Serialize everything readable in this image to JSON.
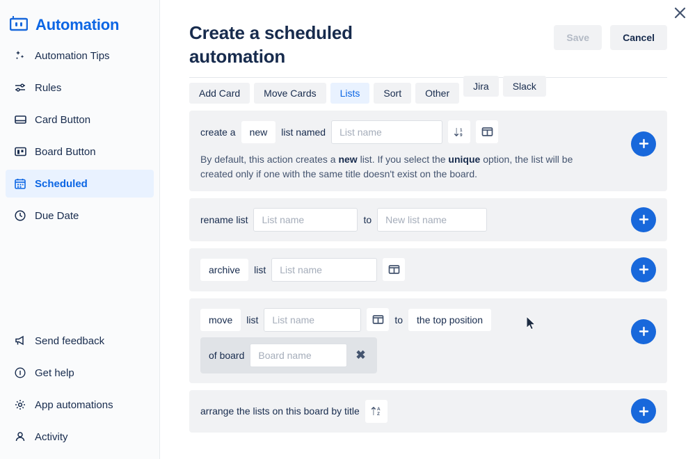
{
  "sidebar": {
    "brand": {
      "label": "Automation",
      "icon": "robot-icon"
    },
    "items": [
      {
        "label": "Automation Tips",
        "icon": "sparkles-icon",
        "active": false
      },
      {
        "label": "Rules",
        "icon": "sliders-icon",
        "active": false
      },
      {
        "label": "Card Button",
        "icon": "card-icon",
        "active": false
      },
      {
        "label": "Board Button",
        "icon": "board-icon",
        "active": false
      },
      {
        "label": "Scheduled",
        "icon": "calendar-icon",
        "active": true
      },
      {
        "label": "Due Date",
        "icon": "clock-icon",
        "active": false
      }
    ],
    "bottom_items": [
      {
        "label": "Send feedback",
        "icon": "megaphone-icon"
      },
      {
        "label": "Get help",
        "icon": "info-icon"
      },
      {
        "label": "App automations",
        "icon": "gear-icon"
      },
      {
        "label": "Activity",
        "icon": "person-icon"
      }
    ]
  },
  "header": {
    "title": "Create a scheduled automation",
    "save_label": "Save",
    "cancel_label": "Cancel",
    "close_icon": "close-icon"
  },
  "tabs": [
    {
      "label": "Add Card",
      "active": false,
      "raised": false
    },
    {
      "label": "Move Cards",
      "active": false,
      "raised": false
    },
    {
      "label": "Lists",
      "active": true,
      "raised": false
    },
    {
      "label": "Sort",
      "active": false,
      "raised": false
    },
    {
      "label": "Other",
      "active": false,
      "raised": false
    },
    {
      "label": "Jira",
      "active": false,
      "raised": true
    },
    {
      "label": "Slack",
      "active": false,
      "raised": true
    }
  ],
  "actions": {
    "create": {
      "prefix": "create a",
      "mode": "new",
      "middle": "list named",
      "list_name_placeholder": "List name",
      "sort_icon": "sort-descending-icon",
      "board_icon": "board-columns-icon",
      "add_icon": "plus-icon",
      "help_pre": "By default, this action creates a ",
      "help_bold1": "new",
      "help_mid": " list. If you select the ",
      "help_bold2": "unique",
      "help_post": " option, the list will be created only if one with the same title doesn't exist on the board."
    },
    "rename": {
      "prefix": "rename list",
      "list_name_placeholder": "List name",
      "connector": "to",
      "new_name_placeholder": "New list name",
      "add_icon": "plus-icon"
    },
    "archive": {
      "mode": "archive",
      "label": "list",
      "list_name_placeholder": "List name",
      "board_icon": "board-columns-icon",
      "add_icon": "plus-icon"
    },
    "move": {
      "mode": "move",
      "label": "list",
      "list_name_placeholder": "List name",
      "board_icon": "board-columns-icon",
      "connector": "to",
      "position": "the top position",
      "sub_label": "of board",
      "board_name_placeholder": "Board name",
      "remove_icon": "close-icon",
      "add_icon": "plus-icon"
    },
    "arrange": {
      "text": "arrange the lists on this board by title",
      "sort_icon": "sort-ascending-az-icon",
      "add_icon": "plus-icon"
    }
  },
  "colors": {
    "brand_blue": "#0c66e4",
    "accent_blue": "#1868db",
    "card_bg": "#f1f2f4",
    "active_tab_bg": "#e9f2ff",
    "text_dark": "#172b4d",
    "text_muted": "#44546f"
  }
}
